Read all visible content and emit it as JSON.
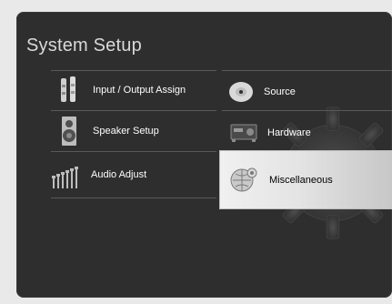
{
  "page": {
    "title": "System Setup"
  },
  "menu": {
    "left": [
      {
        "label": "Input / Output Assign",
        "icon": "rca-connectors-icon"
      },
      {
        "label": "Speaker Setup",
        "icon": "speaker-icon"
      },
      {
        "label": "Audio Adjust",
        "icon": "equalizer-bars-icon"
      }
    ],
    "right": [
      {
        "label": "Source",
        "icon": "disc-icon"
      },
      {
        "label": "Hardware",
        "icon": "receiver-device-icon"
      },
      {
        "label": "Miscellaneous",
        "icon": "globe-gear-icon",
        "selected": true
      }
    ]
  },
  "colors": {
    "background": "#2e2e2e",
    "text": "#ffffff",
    "highlight": "#e9e9e9"
  }
}
